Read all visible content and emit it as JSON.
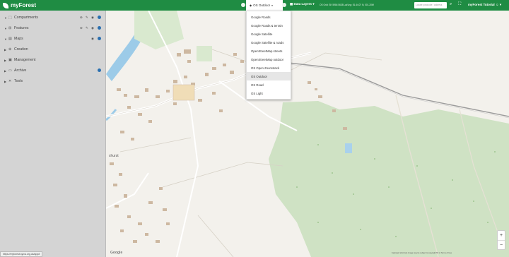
{
  "app": {
    "name": "myForest",
    "accent": "#1f8c43"
  },
  "topbar": {
    "layer_button": "OS Outdoor",
    "data_layers": "Data Layers",
    "coords": "OS Grid: SK 5984 5638   Lat/Lng: 51.44.07 N, 001.20W",
    "search_placeholder": "Locate postcode / address",
    "user_menu": "myForest Tutorial"
  },
  "sidebar": {
    "items": [
      {
        "label": "Compartments",
        "icon": "compartments-icon"
      },
      {
        "label": "Features",
        "icon": "features-icon"
      },
      {
        "label": "Maps",
        "icon": "maps-icon"
      },
      {
        "label": "Creation",
        "icon": "creation-icon"
      },
      {
        "label": "Management",
        "icon": "management-icon"
      },
      {
        "label": "Archive",
        "icon": "archive-icon"
      },
      {
        "label": "Tools",
        "icon": "tools-icon"
      }
    ]
  },
  "basemap_menu": {
    "items": [
      "Google Roads",
      "Google Roads & terrain",
      "Google Satellite",
      "Google Satellite & roads",
      "OpenStreetMap streets",
      "OpenStreetMap outdoor",
      "OS Open Zoomstack",
      "OS Outdoor",
      "OS Road",
      "OS Light"
    ],
    "selected": "OS Outdoor"
  },
  "map": {
    "place_label": "xhurst",
    "zoom_in": "+",
    "zoom_out": "−",
    "attribution": "Keyboard shortcuts   Image may be subject to copyright   50 m   Terms of Use",
    "google": "Google"
  },
  "status_url": "https://myforest.sylva.org.uk/app#"
}
